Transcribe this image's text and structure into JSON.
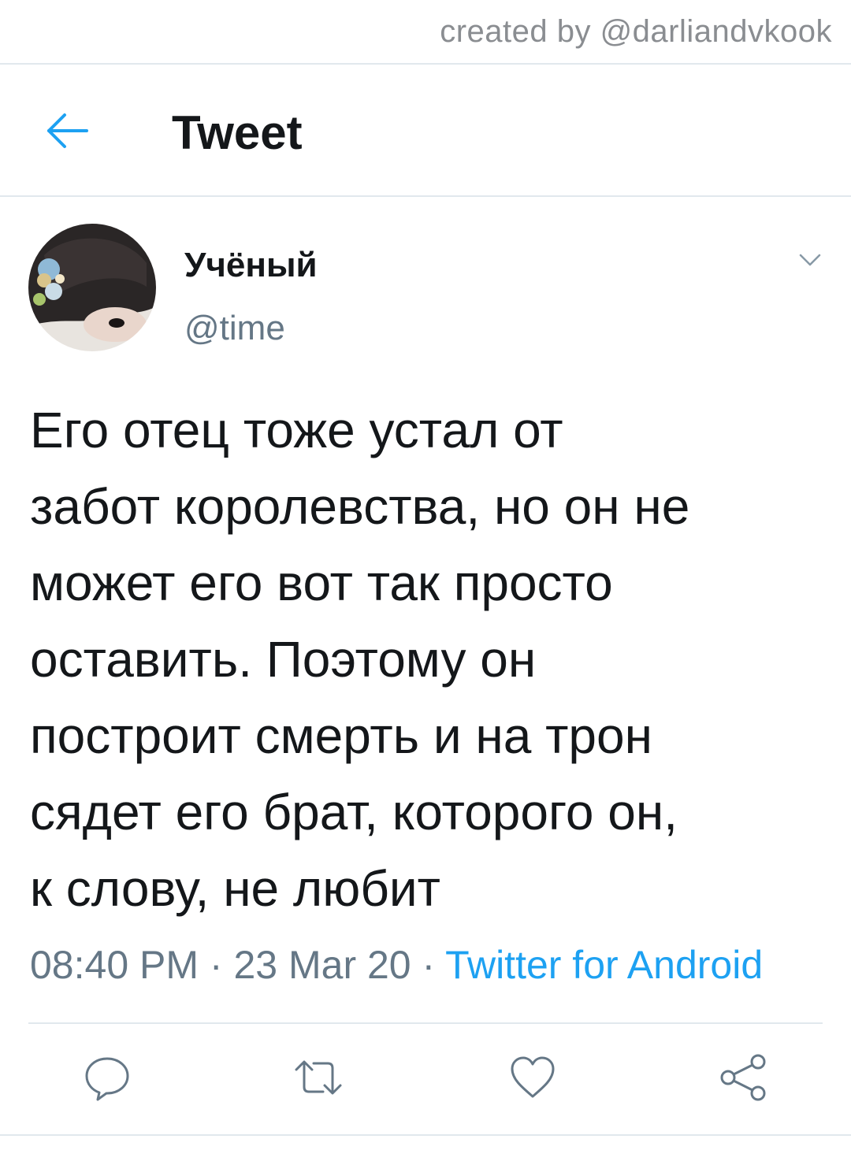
{
  "watermark": "created by @darliandvkook",
  "header": {
    "back_icon": "arrow-left-icon",
    "title": "Tweet"
  },
  "author": {
    "display_name": "Учёный",
    "handle": "@time",
    "avatar_icon": "avatar-photo"
  },
  "tweet": {
    "lines": [
      "Его отец тоже устал от",
      "забот королевства, но он не",
      "может его вот так просто",
      "оставить. Поэтому он",
      "построит смерть и на трон",
      "сядет его брат, которого он,",
      "к слову, не любит"
    ],
    "time": "08:40 PM",
    "date": "23 Mar 20",
    "separator": "·",
    "source": "Twitter for Android"
  },
  "actions": {
    "reply_icon": "reply-icon",
    "retweet_icon": "retweet-icon",
    "like_icon": "heart-icon",
    "share_icon": "share-icon"
  },
  "colors": {
    "accent": "#1da1f2",
    "secondary_text": "#657786",
    "divider": "#e1e8ed",
    "icon_gray": "#657786"
  }
}
